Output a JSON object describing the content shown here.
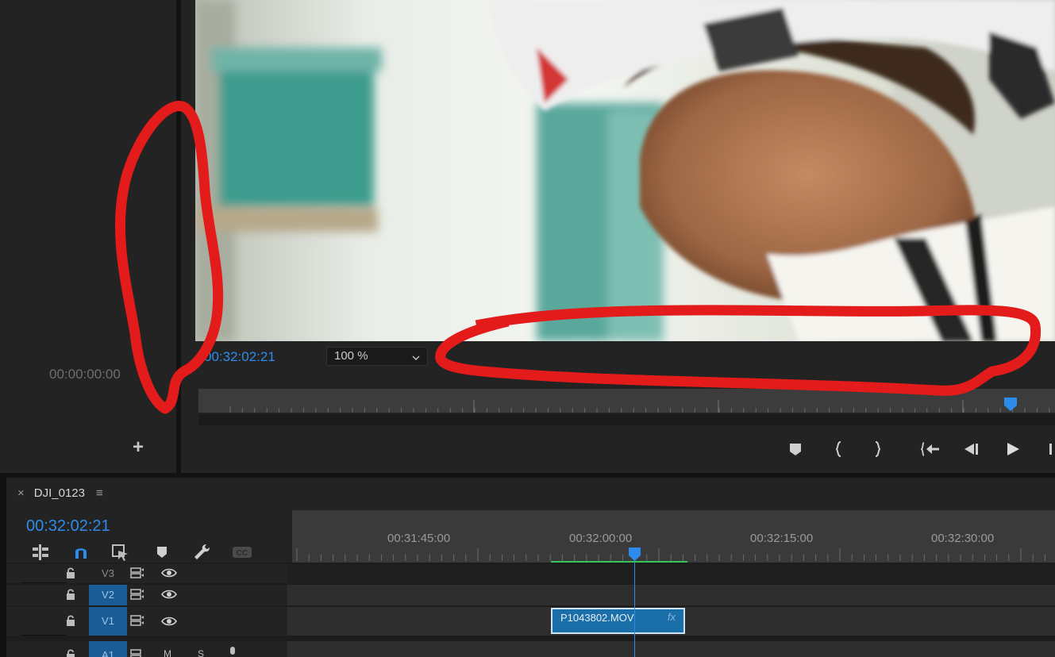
{
  "source_monitor": {
    "timecode": "00:00:00:00",
    "add_button": "+"
  },
  "program_monitor": {
    "timecode": "00:32:02:21",
    "zoom": "100 %"
  },
  "timeline": {
    "sequence_name": "DJI_0123",
    "close_symbol": "×",
    "menu_symbol": "≡",
    "timecode": "00:32:02:21",
    "ruler_labels": [
      "00:31:45:00",
      "00:32:00:00",
      "00:32:15:00",
      "00:32:30:00"
    ],
    "tracks": [
      {
        "label": "V3",
        "targeted": false
      },
      {
        "label": "V2",
        "targeted": true
      },
      {
        "label": "V1",
        "targeted": true
      },
      {
        "label": "A1",
        "targeted": true,
        "m": "M",
        "s": "S"
      }
    ],
    "clip": {
      "name": "P1043802.MOV",
      "fx": "fx"
    }
  },
  "colors": {
    "accent": "#2d8ceb",
    "clip": "#1b6fa8",
    "work_area": "#37c45a",
    "annotation": "#e31b1b"
  }
}
